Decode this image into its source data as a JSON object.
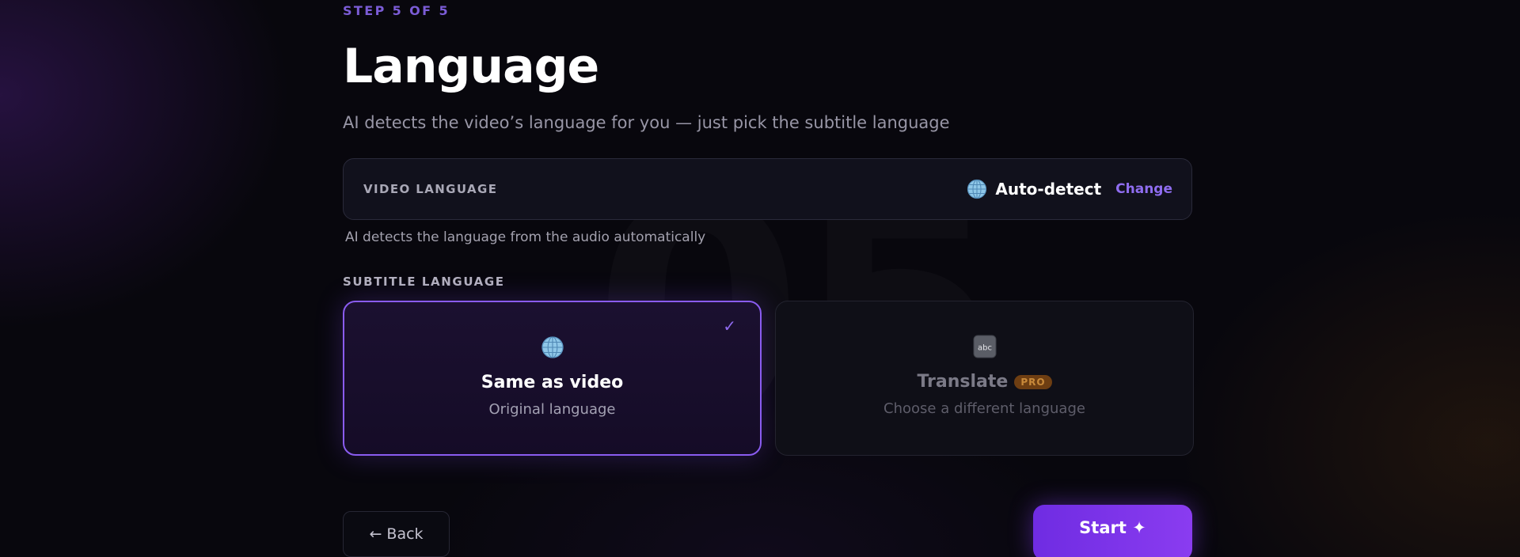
{
  "header": {
    "step": "STEP 5 OF 5",
    "title": "Language",
    "subtitle": "AI detects the video’s language for you — just pick the subtitle language"
  },
  "background": {
    "number": "05"
  },
  "video_language": {
    "label": "VIDEO LANGUAGE",
    "icon": "globe-icon",
    "value": "Auto-detect",
    "change_label": "Change",
    "hint": "AI detects the language from the audio automatically"
  },
  "subtitle_language": {
    "label": "SUBTITLE LANGUAGE",
    "options": [
      {
        "icon": "globe-icon",
        "title": "Same as video",
        "description": "Original language",
        "selected": true,
        "check": "✓"
      },
      {
        "icon": "abc-icon",
        "title": "Translate",
        "badge": "PRO",
        "description": "Choose a different language",
        "selected": false
      }
    ]
  },
  "footer": {
    "back_label": "← Back",
    "start_label": "Start ✦"
  },
  "colors": {
    "accent": "#8a5cf0",
    "background": "#08070d",
    "pro_badge": "#6e3e12"
  }
}
